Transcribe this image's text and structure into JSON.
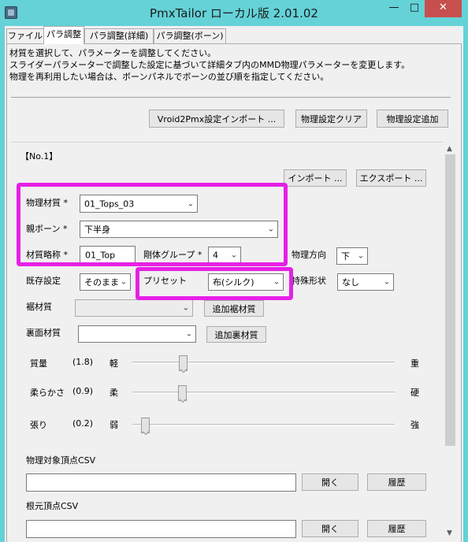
{
  "window": {
    "title": "PmxTailor ローカル版 2.01.02",
    "minimize": "—",
    "maximize": "□",
    "close": "✕",
    "icon": "app-icon"
  },
  "tabs": [
    {
      "label": "ファイル"
    },
    {
      "label": "パラ調整"
    },
    {
      "label": "パラ調整(詳細)"
    },
    {
      "label": "パラ調整(ボーン)"
    }
  ],
  "description": [
    "材質を選択して、パラメーターを調整してください。",
    "スライダーパラメーターで調整した設定に基づいて詳細タブ内のMMD物理パラメーターを変更します。",
    "物理を再利用したい場合は、ボーンパネルでボーンの並び順を指定してください。"
  ],
  "toolbar": {
    "import_button": "Vroid2Pmx設定インポート ...",
    "clear_button": "物理設定クリア",
    "add_button": "物理設定追加"
  },
  "panel": {
    "heading": "【No.1】",
    "import_button": "インポート ...",
    "export_button": "エクスポート ...",
    "physics_material": {
      "label": "物理材質 *",
      "value": "01_Tops_03"
    },
    "parent_bone": {
      "label": "親ボーン *",
      "value": "下半身"
    },
    "material_abbr": {
      "label": "材質略称 *",
      "value": "01_Top"
    },
    "rigid_group": {
      "label": "剛体グループ *",
      "value": "4"
    },
    "physics_direction": {
      "label": "物理方向",
      "value": "下"
    },
    "existing_setting": {
      "label": "既存設定",
      "value": "そのまま"
    },
    "preset": {
      "label": "プリセット",
      "value": "布(シルク)"
    },
    "special_shape": {
      "label": "特殊形状",
      "value": "なし"
    },
    "hem_material": {
      "label": "裾材質",
      "value": "",
      "button": "追加裾材質"
    },
    "back_material": {
      "label": "裏面材質",
      "value": "",
      "button": "追加裏材質"
    },
    "sliders": [
      {
        "label": "質量",
        "value": "(1.8)",
        "min_label": "軽",
        "max_label": "重",
        "position": 0.19
      },
      {
        "label": "柔らかさ",
        "value": "(0.9)",
        "min_label": "柔",
        "max_label": "硬",
        "position": 0.19
      },
      {
        "label": "張り",
        "value": "(0.2)",
        "min_label": "弱",
        "max_label": "強",
        "position": 0.05
      }
    ],
    "vertex_csv": {
      "label": "物理対象頂点CSV",
      "value": "",
      "open_button": "開く",
      "history_button": "履歴"
    },
    "root_csv": {
      "label": "根元頂点CSV",
      "value": "",
      "open_button": "開く",
      "history_button": "履歴"
    }
  },
  "scrollbar": {
    "up": "▲",
    "down": "▼"
  },
  "colors": {
    "title_bar": "#64d2d7",
    "close_button": "#c7504f",
    "highlight": "#e620e6",
    "window_bg": "#f0f0f0"
  }
}
